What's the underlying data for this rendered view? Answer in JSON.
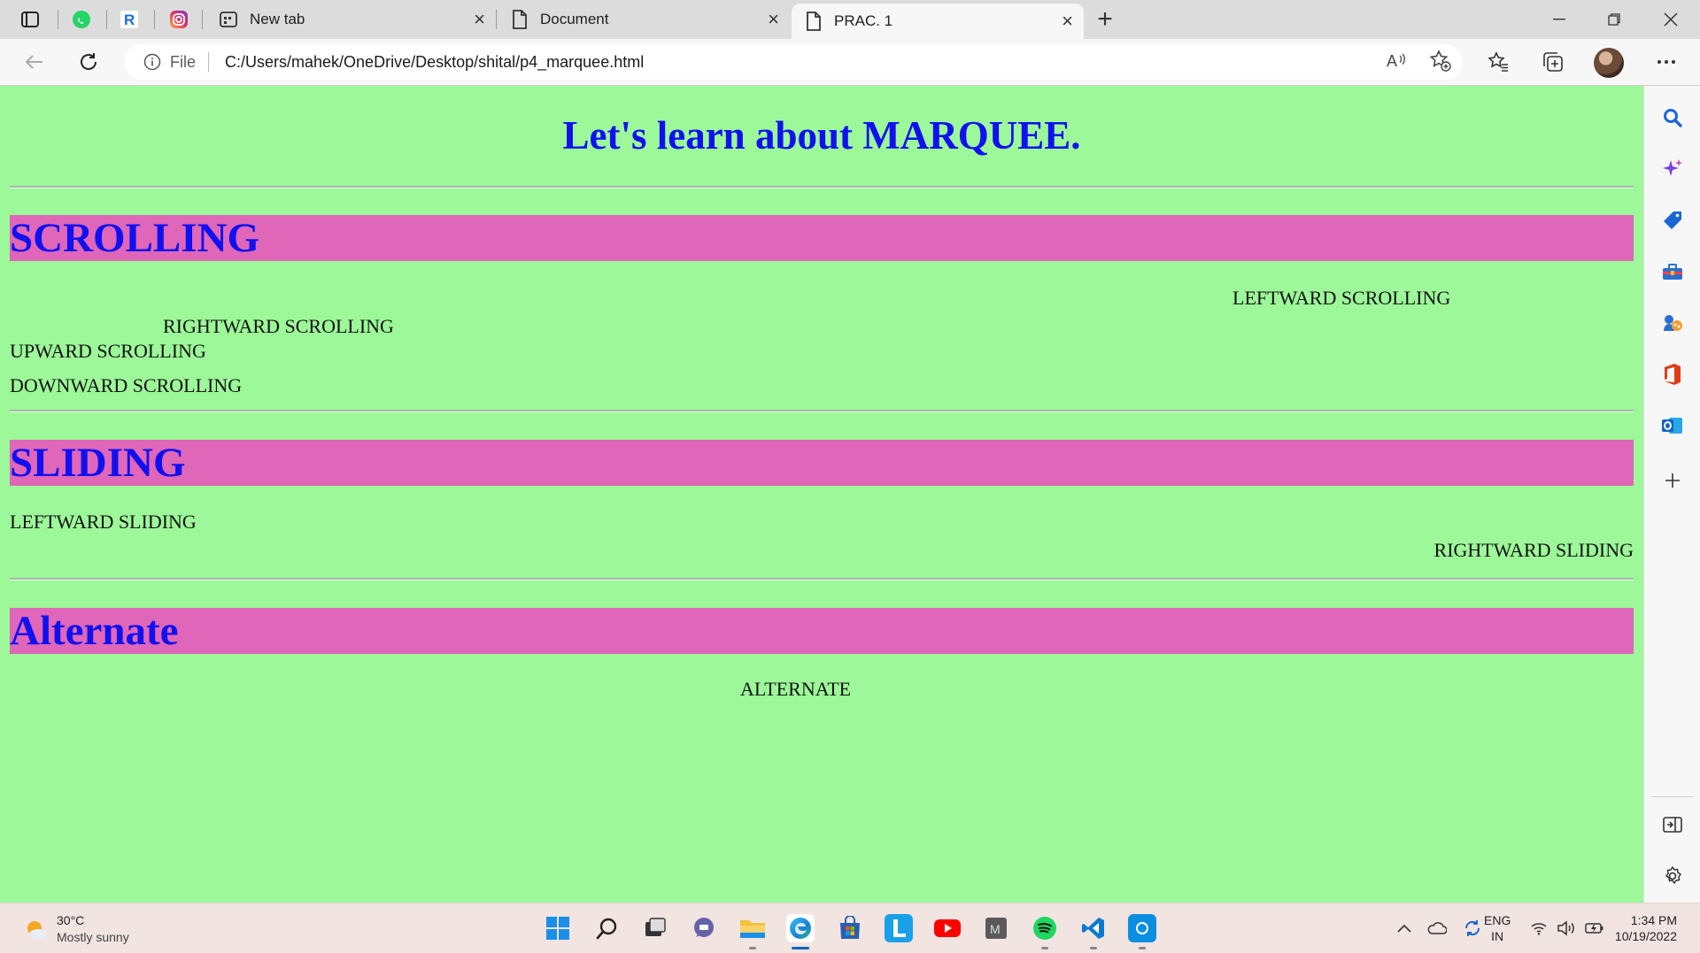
{
  "browser": {
    "tabs": [
      {
        "label": "New tab"
      },
      {
        "label": "Document"
      },
      {
        "label": "PRAC. 1"
      }
    ],
    "address": {
      "scheme_label": "File",
      "url": "C:/Users/mahek/OneDrive/Desktop/shital/p4_marquee.html"
    }
  },
  "page": {
    "title": "Let's learn about MARQUEE.",
    "sections": {
      "scrolling": {
        "heading": "SCROLLING",
        "items": {
          "leftward": "LEFTWARD SCROLLING",
          "rightward": "RIGHTWARD SCROLLING",
          "upward": "UPWARD SCROLLING",
          "downward": "DOWNWARD SCROLLING"
        }
      },
      "sliding": {
        "heading": "SLIDING",
        "items": {
          "leftward": "LEFTWARD SLIDING",
          "rightward": "RIGHTWARD SLIDING"
        }
      },
      "alternate": {
        "heading": "Alternate",
        "items": {
          "alternate": "ALTERNATE"
        }
      }
    },
    "colors": {
      "background": "#9cf898",
      "heading_band": "#df66b8",
      "heading_text": "#1010f0"
    }
  },
  "taskbar": {
    "weather": {
      "temp": "30°C",
      "condition": "Mostly sunny"
    },
    "language": {
      "lang": "ENG",
      "region": "IN"
    },
    "clock": {
      "time": "1:34 PM",
      "date": "10/19/2022"
    }
  }
}
